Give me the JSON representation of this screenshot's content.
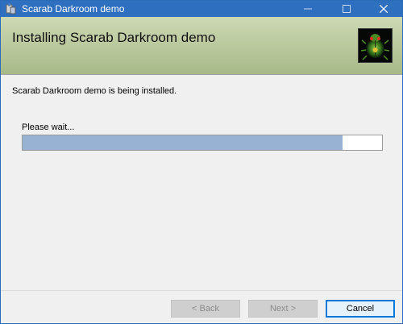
{
  "window": {
    "title": "Scarab Darkroom demo",
    "controls": {
      "minimize_icon": "minimize-icon",
      "maximize_icon": "maximize-icon",
      "close_icon": "close-icon"
    },
    "accent_color": "#2f6fbf"
  },
  "banner": {
    "title": "Installing Scarab Darkroom demo",
    "logo_icon": "scarab-logo-icon",
    "gradient": [
      "#cdd9b4",
      "#a7b988"
    ]
  },
  "body": {
    "status": "Scarab Darkroom demo is being installed.",
    "wait_label": "Please wait...",
    "progress": 0.89,
    "progress_color": "#97b2d2"
  },
  "footer": {
    "back_label": "< Back",
    "next_label": "Next >",
    "cancel_label": "Cancel"
  }
}
